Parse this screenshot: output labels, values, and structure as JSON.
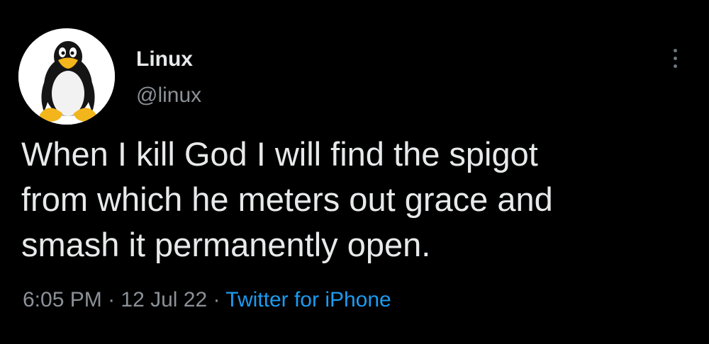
{
  "tweet": {
    "display_name": "Linux",
    "handle": "@linux",
    "avatar_icon": "tux-penguin-icon",
    "more_icon": "more-vertical-icon",
    "text_lines": [
      "When I kill God I will find the spigot",
      "from which he meters out grace and",
      "smash it permanently open."
    ],
    "time": "6:05 PM",
    "separator": " · ",
    "date": "12 Jul 22",
    "source": "Twitter for iPhone"
  },
  "colors": {
    "background": "#000000",
    "text": "#e7e9ea",
    "secondary": "#8b9197",
    "link": "#1d9bf0"
  }
}
